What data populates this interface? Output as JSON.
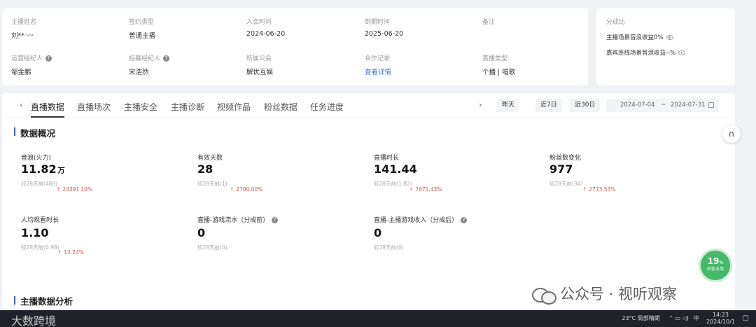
{
  "info": {
    "fields": [
      {
        "label": "主播姓名",
        "value": "刘** 〰"
      },
      {
        "label": "签约类型",
        "value": "普通主播"
      },
      {
        "label": "入会时间",
        "value": "2024-06-20"
      },
      {
        "label": "到期时间",
        "value": "2025-06-20"
      },
      {
        "label": "备注",
        "value": ""
      },
      {
        "label": "运营经纪人",
        "value": "邹金鹏"
      },
      {
        "label": "招募经纪人",
        "value": "宋浩然"
      },
      {
        "label": "所属公会",
        "value": "解优互娱"
      },
      {
        "label": "合作记录",
        "value": "查看详情"
      },
      {
        "label": "直播类型",
        "value": "个播 | 唱歌"
      }
    ]
  },
  "split": {
    "title": "分成比",
    "rows": [
      "主播场景音浪收益0%",
      "嘉宾连线场景音浪收益--%"
    ]
  },
  "tabs": [
    "直播数据",
    "直播场次",
    "主播安全",
    "主播诊断",
    "视频作品",
    "粉丝数据",
    "任务进度"
  ],
  "active_tab": "直播数据",
  "date_buttons": [
    "昨天",
    "近7日",
    "近30日"
  ],
  "date_range": {
    "start": "2024-07-04",
    "sep": "~",
    "end": "2024-07-31"
  },
  "overview": {
    "title": "数据概况",
    "metrics": [
      {
        "label": "音浪(火力)",
        "value": "11.82",
        "unit": "万",
        "compare": "较28天前(483)",
        "change": "24391.10%",
        "help": false
      },
      {
        "label": "有效天数",
        "value": "28",
        "unit": "",
        "compare": "较28天前(1)",
        "change": "2700.00%",
        "help": false
      },
      {
        "label": "直播时长",
        "value": "141.44",
        "unit": "",
        "compare": "较28天前(1.82)",
        "change": "7671.43%",
        "help": false
      },
      {
        "label": "粉丝数变化",
        "value": "977",
        "unit": "",
        "compare": "较28天前(34)",
        "change": "2773.53%",
        "help": false
      },
      {
        "label": "人均观看时长",
        "value": "1.10",
        "unit": "",
        "compare": "较28天前(0.98)",
        "change": "12.24%",
        "help": false
      },
      {
        "label": "直播-游戏流水（分成前）",
        "value": "0",
        "unit": "",
        "compare": "较28天前(0)",
        "change": "",
        "help": true
      },
      {
        "label": "直播-主播游戏收入（分成后）",
        "value": "0",
        "unit": "",
        "compare": "较28天前(0)",
        "change": "",
        "help": true
      }
    ]
  },
  "analysis_title": "主播数据分析",
  "gauge": {
    "value": "19",
    "unit": "%",
    "sub": "内存占用"
  },
  "watermark": "公众号 · 视听观察",
  "taskbar": {
    "left_text": "大数跨境",
    "weather": "23°C  局部晴朗",
    "ime": "中",
    "time": "14:23",
    "date": "2024/10/1"
  },
  "colors": {
    "accent": "#3b5bdb",
    "up": "#d9534f",
    "link": "#3b6fd6",
    "gauge": "#46b86b"
  }
}
